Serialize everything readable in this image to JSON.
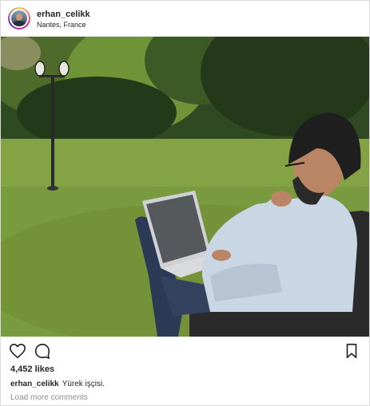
{
  "post": {
    "username": "erhan_celikk",
    "location": "Nantes, France",
    "likes": "4,452 likes",
    "caption_user": "erhan_celikk",
    "caption_text": "Yürek işçisi.",
    "load_more": "Load more comments"
  },
  "icons": {
    "like": "heart-icon",
    "comment": "comment-icon",
    "save": "bookmark-icon"
  },
  "colors": {
    "text": "#262626",
    "muted": "#8e8e8e",
    "border": "#dbdbdb"
  }
}
